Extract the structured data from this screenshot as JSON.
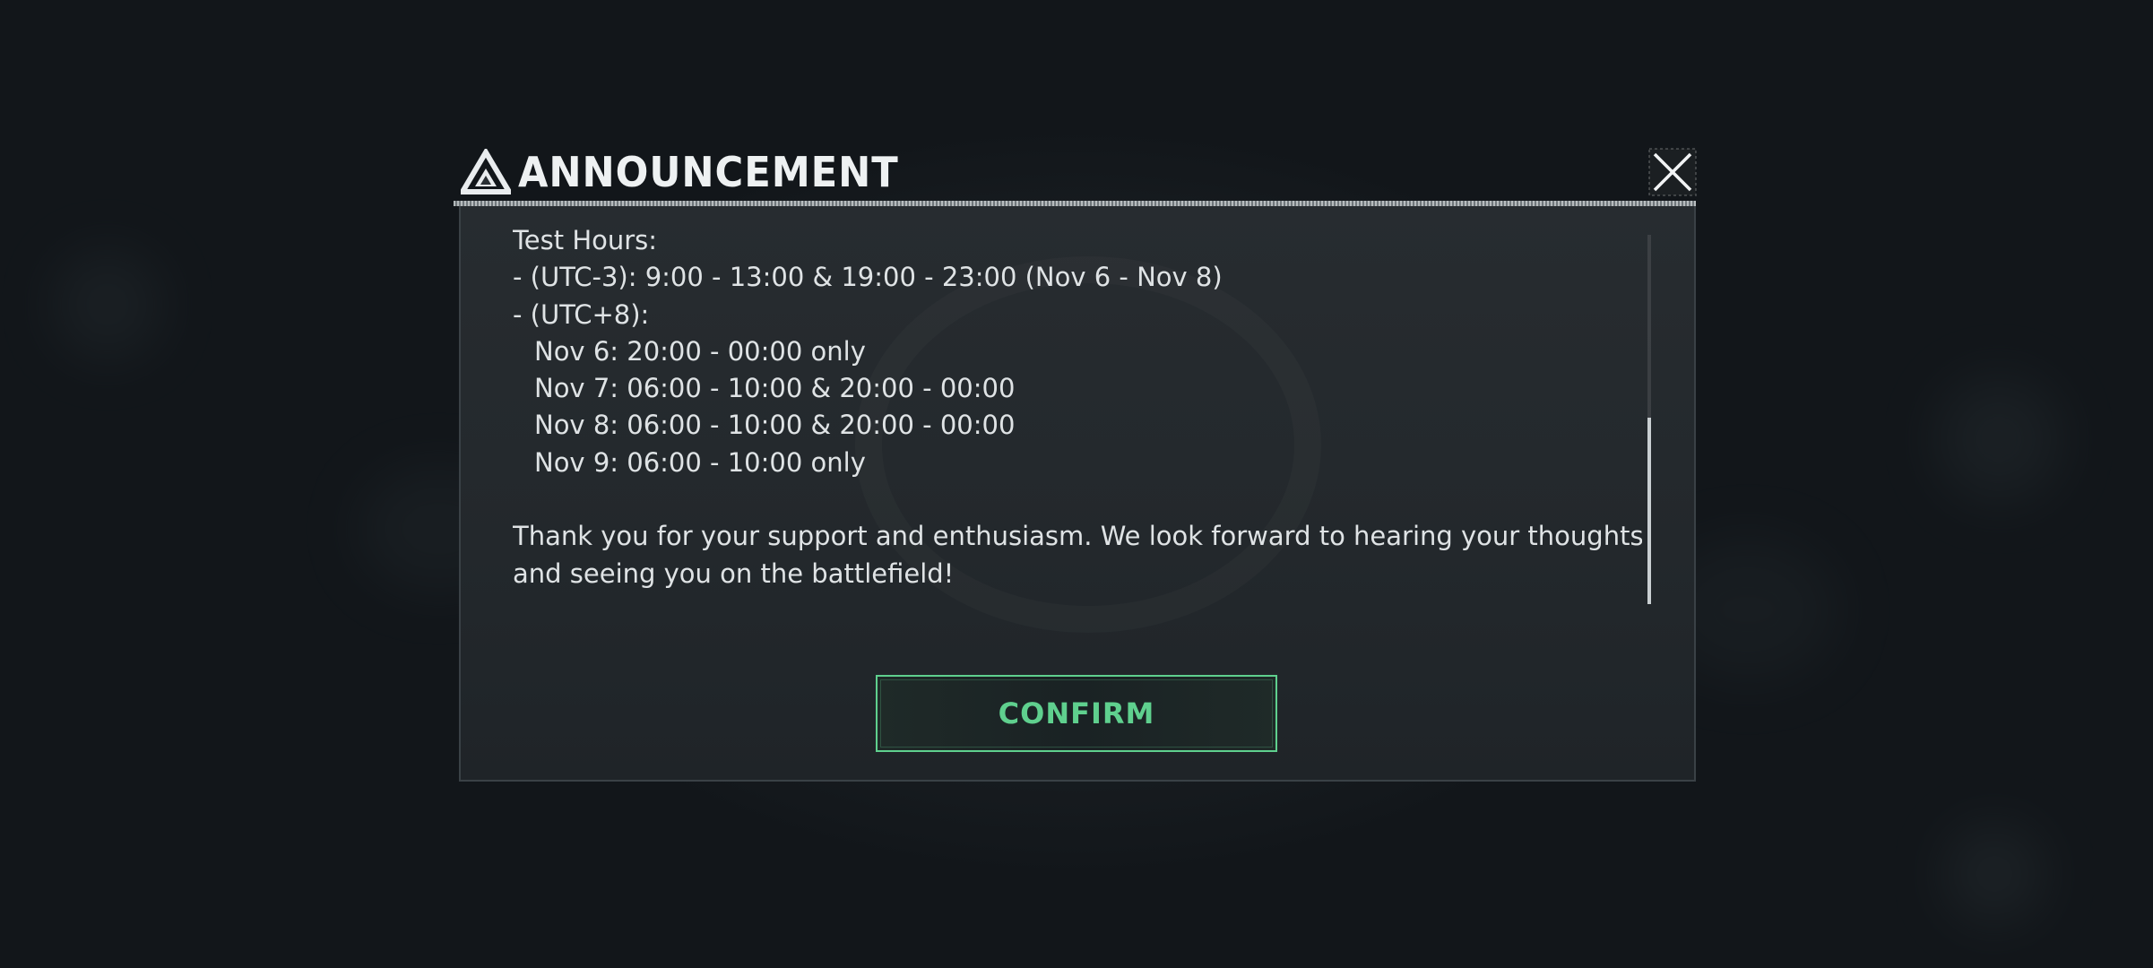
{
  "dialog": {
    "title": "ANNOUNCEMENT",
    "header_small_text": "",
    "lines": [
      "Test Hours:",
      "- (UTC-3): 9:00 - 13:00 & 19:00 - 23:00 (Nov 6 - Nov 8)",
      "- (UTC+8):",
      "Nov 6: 20:00 - 00:00 only",
      "Nov 7: 06:00 - 10:00 & 20:00 - 00:00",
      "Nov 8: 06:00 - 10:00 & 20:00 - 00:00",
      "Nov 9: 06:00 - 10:00 only",
      "",
      "Thank you for your support and enthusiasm. We look forward to hearing your thoughts",
      "and seeing you on the battlefield!"
    ],
    "confirm_label": "CONFIRM",
    "close_icon": "close-icon",
    "logo_icon": "triangle-logo-icon"
  },
  "colors": {
    "accent": "#5fd08e",
    "panel": "#272c30",
    "text": "#dfe3e5"
  }
}
